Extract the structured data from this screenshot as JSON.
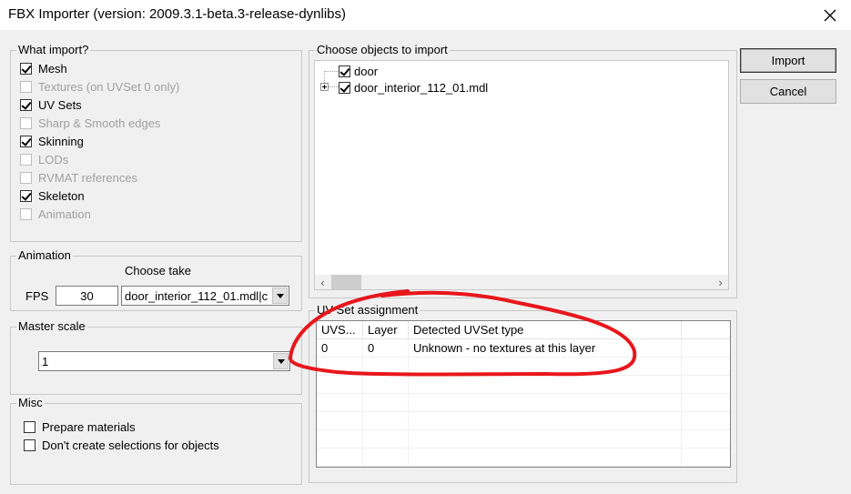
{
  "window": {
    "title": "FBX Importer (version: 2009.3.1-beta.3-release-dynlibs)"
  },
  "what_import": {
    "legend": "What import?",
    "items": [
      {
        "label": "Mesh",
        "checked": true,
        "enabled": true
      },
      {
        "label": "Textures (on UVSet 0 only)",
        "checked": false,
        "enabled": false
      },
      {
        "label": "UV Sets",
        "checked": true,
        "enabled": true
      },
      {
        "label": "Sharp & Smooth edges",
        "checked": false,
        "enabled": false
      },
      {
        "label": "Skinning",
        "checked": true,
        "enabled": true
      },
      {
        "label": "LODs",
        "checked": false,
        "enabled": false
      },
      {
        "label": "RVMAT references",
        "checked": false,
        "enabled": false
      },
      {
        "label": "Skeleton",
        "checked": true,
        "enabled": true
      },
      {
        "label": "Animation",
        "checked": false,
        "enabled": false
      }
    ]
  },
  "animation": {
    "legend": "Animation",
    "choose_take_label": "Choose take",
    "fps_label": "FPS",
    "fps_value": "30",
    "take_value": "door_interior_112_01.mdl|c"
  },
  "master_scale": {
    "legend": "Master scale",
    "value": "1"
  },
  "misc": {
    "legend": "Misc",
    "items": [
      {
        "label": "Prepare materials",
        "checked": false
      },
      {
        "label": "Don't create selections for objects",
        "checked": false
      }
    ]
  },
  "objects": {
    "legend": "Choose objects to import",
    "items": [
      {
        "label": "door",
        "checked": true,
        "expandable": false
      },
      {
        "label": "door_interior_112_01.mdl",
        "checked": true,
        "expandable": true
      }
    ],
    "scroll_left": "‹",
    "scroll_right": "›"
  },
  "uvset": {
    "legend": "UV Set assignment",
    "columns": [
      "UVS...",
      "Layer",
      "Detected UVSet type",
      ""
    ],
    "rows": [
      [
        "0",
        "0",
        "Unknown - no textures at this layer",
        ""
      ]
    ],
    "empty_rows": 6,
    "annotation_color": "#e8161b"
  },
  "buttons": {
    "import": "Import",
    "cancel": "Cancel"
  }
}
